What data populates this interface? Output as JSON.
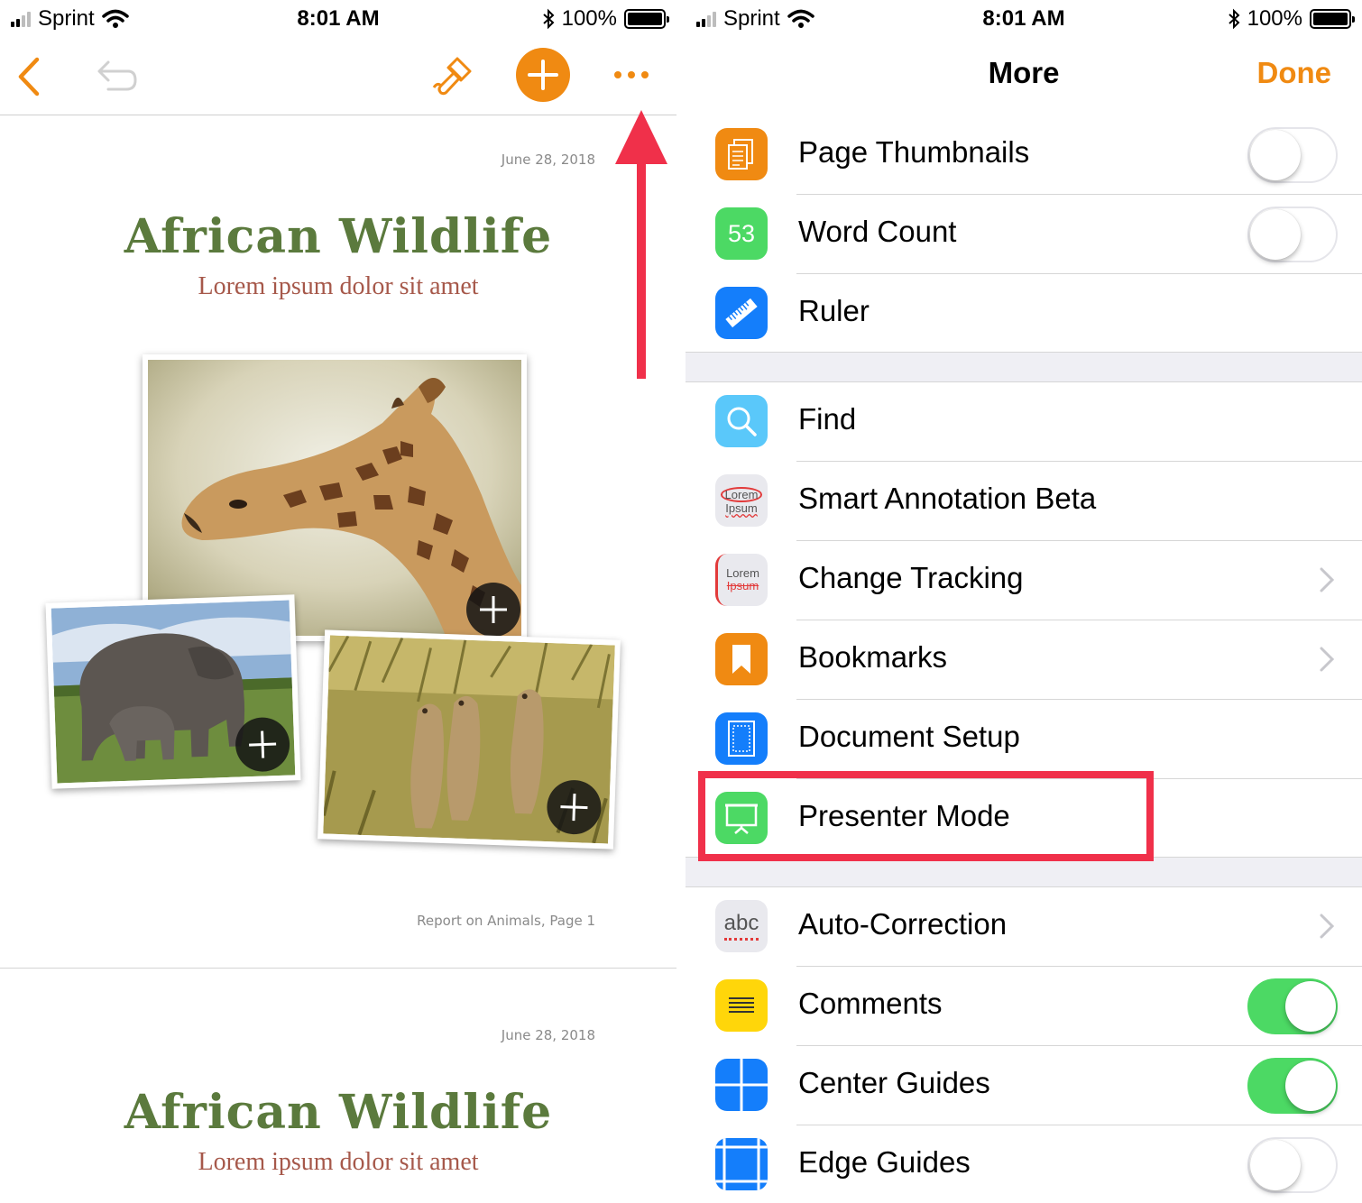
{
  "status_bar": {
    "carrier": "Sprint",
    "time": "8:01 AM",
    "battery": "100%"
  },
  "toolbar": {
    "back_icon": "chevron-left-icon",
    "undo_icon": "undo-icon",
    "format_icon": "paintbrush-icon",
    "add_icon": "plus-icon",
    "more_icon": "ellipsis-icon",
    "accent_color": "#f08a12"
  },
  "document": {
    "pages": [
      {
        "date": "June 28, 2018",
        "title": "African Wildlife",
        "subtitle": "Lorem ipsum dolor sit amet",
        "footer": "Report on Animals, Page 1"
      },
      {
        "date": "June 28, 2018",
        "title": "African Wildlife",
        "subtitle": "Lorem ipsum dolor sit amet"
      }
    ],
    "photos": [
      "giraffe",
      "elephants",
      "meerkats"
    ]
  },
  "more_panel": {
    "title": "More",
    "done_label": "Done",
    "groups": [
      {
        "items": [
          {
            "id": "page-thumbnails",
            "label": "Page Thumbnails",
            "icon": "page-thumbnails-icon",
            "control": "toggle",
            "on": false
          },
          {
            "id": "word-count",
            "label": "Word Count",
            "icon": "word-count-icon",
            "icon_text": "53",
            "control": "toggle",
            "on": false
          },
          {
            "id": "ruler",
            "label": "Ruler",
            "icon": "ruler-icon",
            "control": "none"
          }
        ]
      },
      {
        "items": [
          {
            "id": "find",
            "label": "Find",
            "icon": "search-icon",
            "control": "none"
          },
          {
            "id": "smart-annotation",
            "label": "Smart Annotation Beta",
            "icon": "smart-annotation-icon",
            "icon_text": [
              "Lorem",
              "Ipsum"
            ],
            "control": "none"
          },
          {
            "id": "change-tracking",
            "label": "Change Tracking",
            "icon": "change-tracking-icon",
            "icon_text": [
              "Lorem",
              "Ipsum"
            ],
            "control": "chevron"
          },
          {
            "id": "bookmarks",
            "label": "Bookmarks",
            "icon": "bookmark-icon",
            "control": "chevron"
          },
          {
            "id": "document-setup",
            "label": "Document Setup",
            "icon": "document-setup-icon",
            "control": "none"
          },
          {
            "id": "presenter-mode",
            "label": "Presenter Mode",
            "icon": "presenter-icon",
            "control": "none",
            "highlighted": true
          }
        ]
      },
      {
        "items": [
          {
            "id": "auto-correction",
            "label": "Auto-Correction",
            "icon": "auto-correction-icon",
            "icon_text": "abc",
            "control": "chevron"
          },
          {
            "id": "comments",
            "label": "Comments",
            "icon": "comments-icon",
            "control": "toggle",
            "on": true
          },
          {
            "id": "center-guides",
            "label": "Center Guides",
            "icon": "center-guides-icon",
            "control": "toggle",
            "on": true
          },
          {
            "id": "edge-guides",
            "label": "Edge Guides",
            "icon": "edge-guides-icon",
            "control": "toggle",
            "on": false
          }
        ]
      }
    ]
  },
  "annotations": {
    "arrow_color": "#f0304a",
    "highlight_color": "#f0304a"
  }
}
